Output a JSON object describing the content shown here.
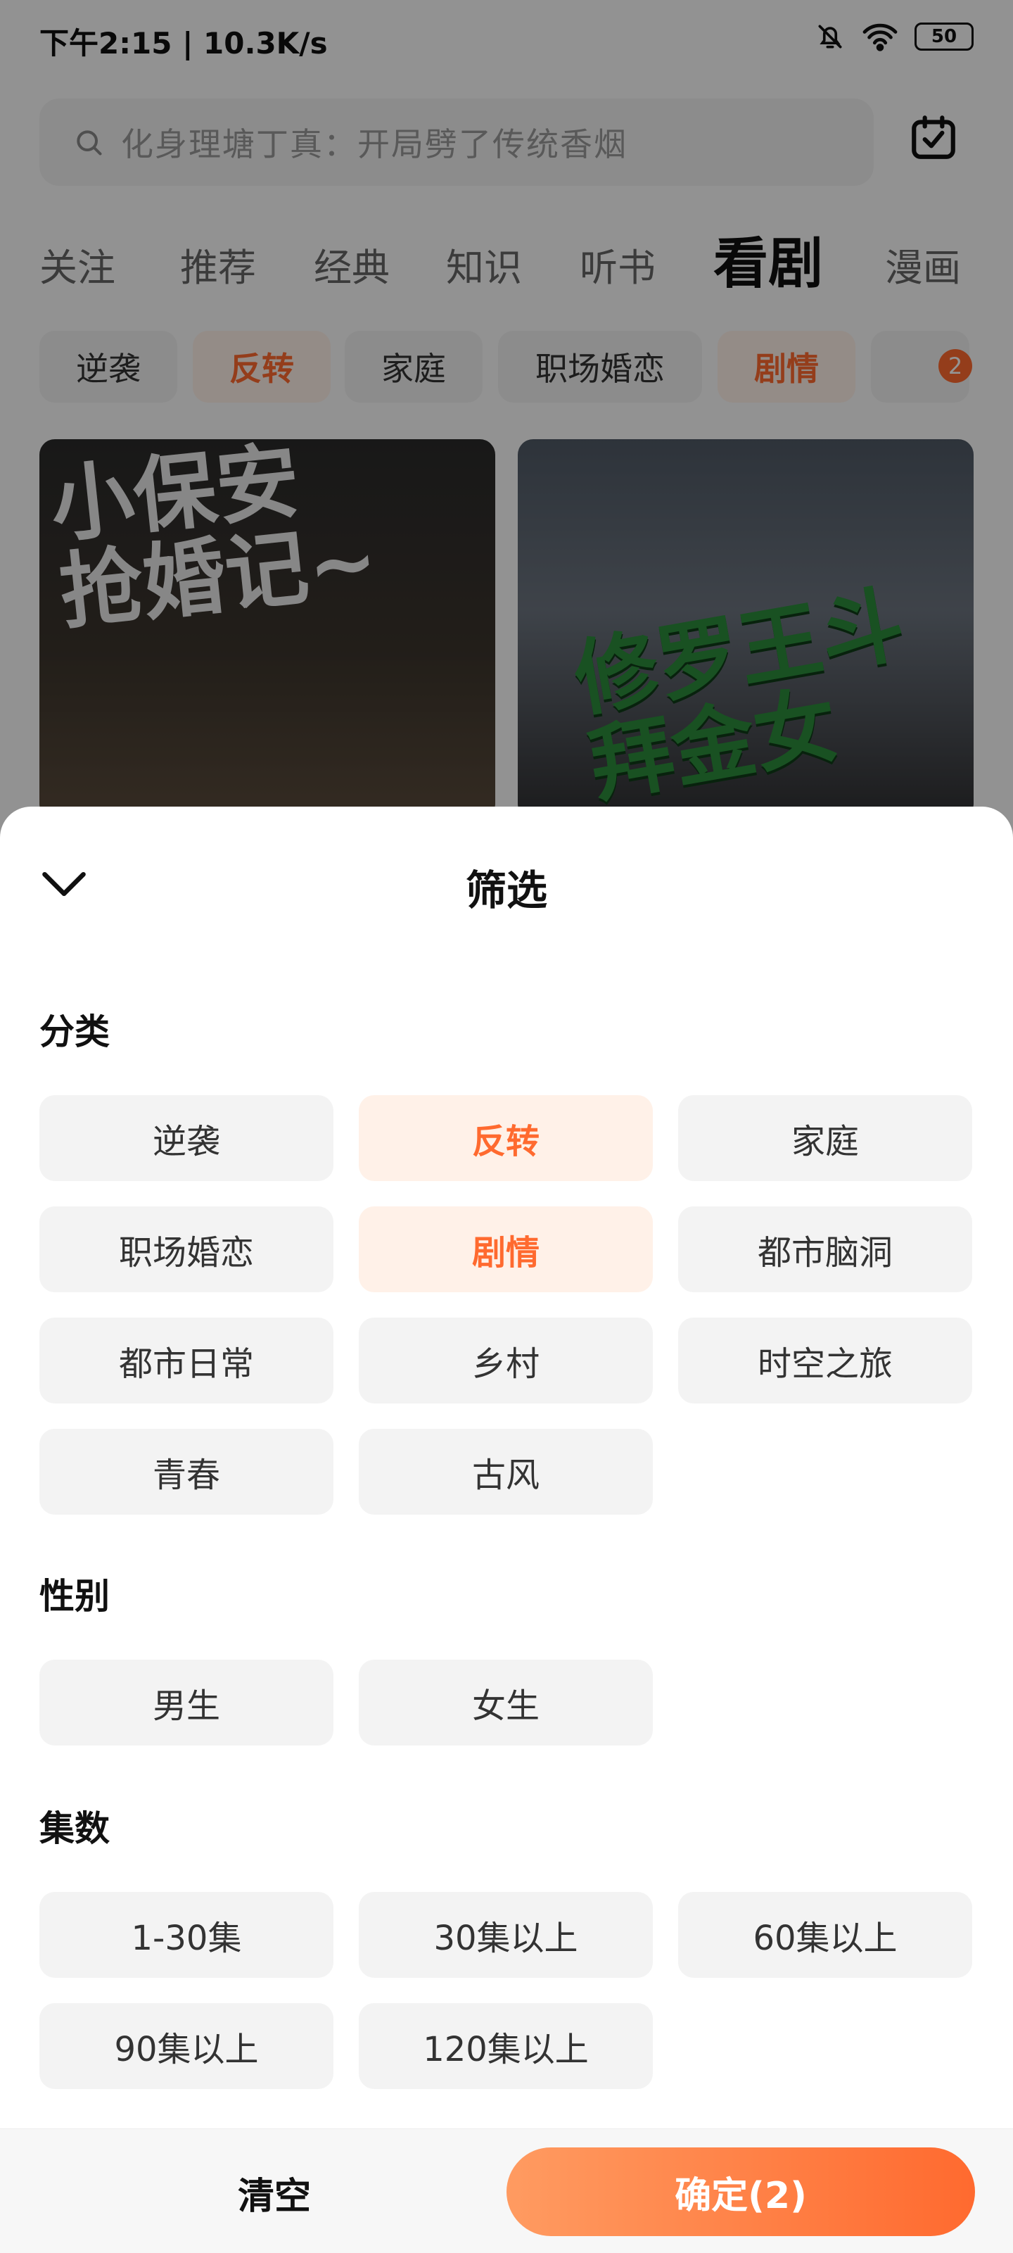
{
  "status_bar": {
    "time_speed": "下午2:15 | 10.3K/s",
    "battery": "50"
  },
  "search": {
    "placeholder": "化身理塘丁真：开局劈了传统香烟"
  },
  "tabs": [
    "关注",
    "推荐",
    "经典",
    "知识",
    "听书",
    "看剧",
    "漫画"
  ],
  "category_chips": [
    {
      "label": "逆袭",
      "selected": false
    },
    {
      "label": "反转",
      "selected": true
    },
    {
      "label": "家庭",
      "selected": false
    },
    {
      "label": "职场婚恋",
      "selected": false
    },
    {
      "label": "剧情",
      "selected": true
    }
  ],
  "filter_badge_count": "2",
  "thumbs": [
    {
      "poster_text": "小保安\n抢婚记~"
    },
    {
      "poster_text": "修罗王斗\n拜金女"
    }
  ],
  "sheet": {
    "title": "筛选",
    "sections": {
      "category": {
        "title": "分类",
        "options": [
          {
            "label": "逆袭",
            "selected": false
          },
          {
            "label": "反转",
            "selected": true
          },
          {
            "label": "家庭",
            "selected": false
          },
          {
            "label": "职场婚恋",
            "selected": false
          },
          {
            "label": "剧情",
            "selected": true
          },
          {
            "label": "都市脑洞",
            "selected": false
          },
          {
            "label": "都市日常",
            "selected": false
          },
          {
            "label": "乡村",
            "selected": false
          },
          {
            "label": "时空之旅",
            "selected": false
          },
          {
            "label": "青春",
            "selected": false
          },
          {
            "label": "古风",
            "selected": false
          }
        ]
      },
      "gender": {
        "title": "性别",
        "options": [
          {
            "label": "男生",
            "selected": false
          },
          {
            "label": "女生",
            "selected": false
          }
        ]
      },
      "episodes": {
        "title": "集数",
        "options": [
          {
            "label": "1-30集",
            "selected": false
          },
          {
            "label": "30集以上",
            "selected": false
          },
          {
            "label": "60集以上",
            "selected": false
          },
          {
            "label": "90集以上",
            "selected": false
          },
          {
            "label": "120集以上",
            "selected": false
          }
        ]
      }
    }
  },
  "bottom": {
    "clear_label": "清空",
    "confirm_label": "确定(2)"
  },
  "colors": {
    "accent": "#ff6a2f",
    "selected_bg": "#fff1e8"
  }
}
